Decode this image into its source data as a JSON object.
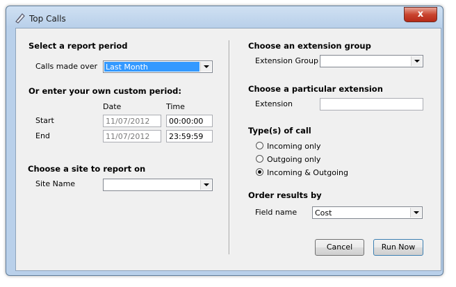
{
  "window": {
    "title": "Top Calls",
    "close_label": "x"
  },
  "left": {
    "report_period": {
      "heading": "Select a report period",
      "calls_label": "Calls made over",
      "calls_value": "Last Month"
    },
    "custom": {
      "heading": "Or enter your own custom period:",
      "date_header": "Date",
      "time_header": "Time",
      "start_label": "Start",
      "start_date": "11/07/2012",
      "start_time": "00:00:00",
      "end_label": "End",
      "end_date": "11/07/2012",
      "end_time": "23:59:59"
    },
    "site": {
      "heading": "Choose a site to report on",
      "label": "Site Name",
      "value": ""
    }
  },
  "right": {
    "ext_group": {
      "heading": "Choose an extension group",
      "label": "Extension Group",
      "value": ""
    },
    "ext": {
      "heading": "Choose a particular extension",
      "label": "Extension",
      "value": ""
    },
    "types": {
      "heading": "Type(s) of call",
      "options": [
        {
          "label": "Incoming only",
          "checked": false
        },
        {
          "label": "Outgoing only",
          "checked": false
        },
        {
          "label": "Incoming & Outgoing",
          "checked": true
        }
      ]
    },
    "order": {
      "heading": "Order results by",
      "label": "Field name",
      "value": "Cost"
    }
  },
  "buttons": {
    "cancel": "Cancel",
    "run": "Run Now"
  }
}
